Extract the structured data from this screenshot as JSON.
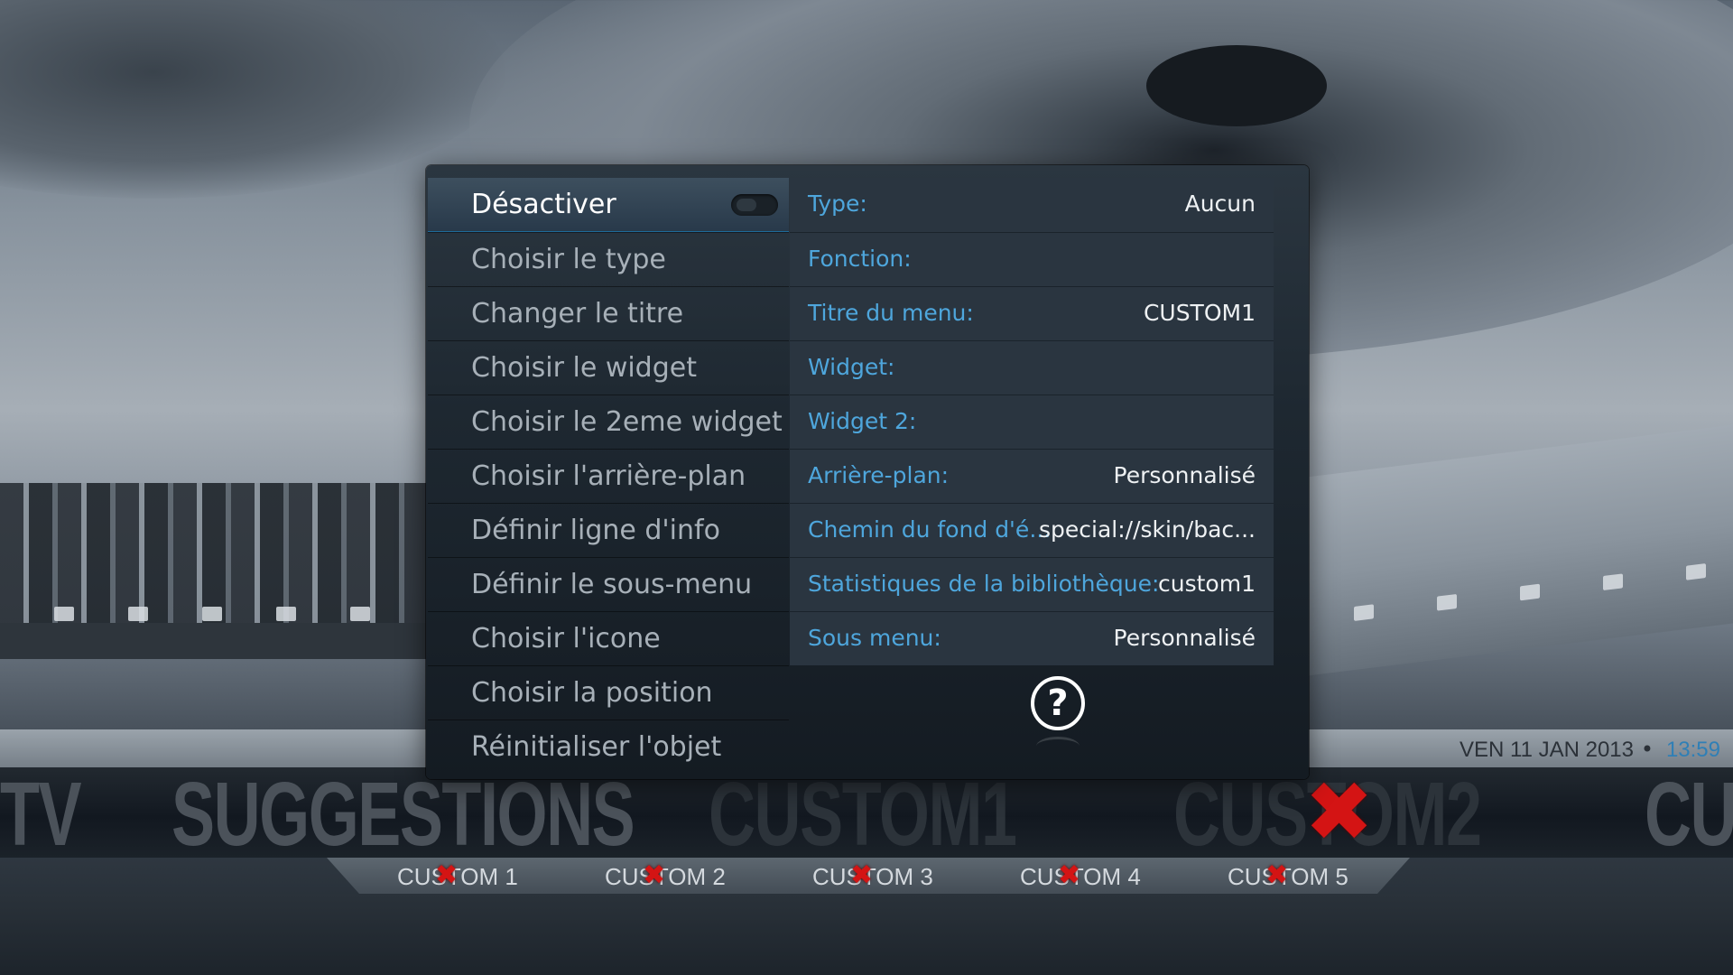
{
  "dialog": {
    "menu": [
      {
        "label": "Désactiver",
        "selected": true
      },
      {
        "label": "Choisir le type"
      },
      {
        "label": "Changer le titre"
      },
      {
        "label": "Choisir le widget"
      },
      {
        "label": "Choisir le 2eme widget"
      },
      {
        "label": "Choisir l'arrière-plan"
      },
      {
        "label": "Définir ligne d'info"
      },
      {
        "label": "Définir le sous-menu"
      },
      {
        "label": "Choisir l'icone"
      },
      {
        "label": "Choisir la position"
      },
      {
        "label": "Réinitialiser l'objet"
      }
    ],
    "properties": [
      {
        "label": "Type:",
        "value": "Aucun"
      },
      {
        "label": "Fonction:",
        "value": ""
      },
      {
        "label": "Titre du menu:",
        "value": "CUSTOM1"
      },
      {
        "label": "Widget:",
        "value": ""
      },
      {
        "label": "Widget 2:",
        "value": ""
      },
      {
        "label": "Arrière-plan:",
        "value": "Personnalisé"
      },
      {
        "label": "Chemin du fond d'é...",
        "value": "special://skin/bac..."
      },
      {
        "label": "Statistiques de la bibliothèque:",
        "value": "custom1"
      },
      {
        "label": "Sous menu:",
        "value": "Personnalisé"
      }
    ],
    "help_glyph": "?",
    "help_icon": "question-circle-icon"
  },
  "status": {
    "date": "VEN 11 JAN 2013",
    "separator": "•",
    "time": "13:59"
  },
  "main_menu": [
    "TV",
    "SUGGESTIONS",
    "CUSTOM1",
    "CUSTOM2",
    "CU"
  ],
  "sub_menu": [
    "CUSTOM 1",
    "CUSTOM 2",
    "CUSTOM 3",
    "CUSTOM 4",
    "CUSTOM 5"
  ],
  "colors": {
    "label_blue": "#4ea6dc",
    "time_blue": "#2f7fb6",
    "delete_red": "#d41414"
  },
  "delete_marker": "✖"
}
